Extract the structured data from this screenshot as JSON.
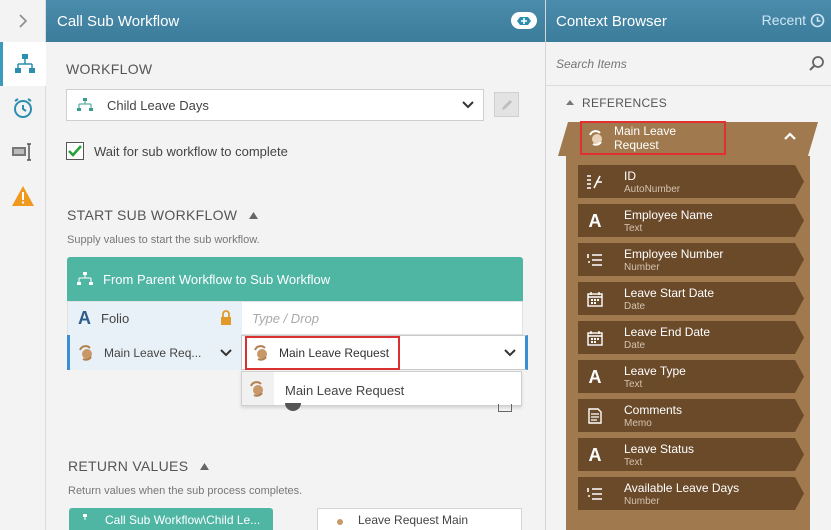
{
  "main": {
    "title": "Call Sub Workflow",
    "workflow_section": "WORKFLOW",
    "workflow_value": "Child Leave Days",
    "wait_label": "Wait for sub workflow to complete",
    "start_section": "START SUB WORKFLOW",
    "start_hint": "Supply values to start the sub workflow.",
    "mapping_title": "From Parent Workflow to Sub Workflow",
    "folio_label": "Folio",
    "value_placeholder": "Type / Drop",
    "param_label": "Main Leave Req...",
    "param_value": "Main Leave Request",
    "dropdown_option": "Main Leave Request",
    "return_section": "RETURN VALUES",
    "return_hint": "Return values when the sub process completes.",
    "return_card1": "Call Sub Workflow\\Child Le...",
    "return_card2": "Leave Request Main"
  },
  "context": {
    "title": "Context Browser",
    "recent_label": "Recent",
    "search_placeholder": "Search Items",
    "references_label": "REFERENCES",
    "reference_name": "Main Leave Request",
    "fields": [
      {
        "name": "ID",
        "type": "AutoNumber",
        "icon": "autonumber-icon"
      },
      {
        "name": "Employee Name",
        "type": "Text",
        "icon": "text-icon"
      },
      {
        "name": "Employee Number",
        "type": "Number",
        "icon": "number-icon"
      },
      {
        "name": "Leave Start Date",
        "type": "Date",
        "icon": "date-icon"
      },
      {
        "name": "Leave End Date",
        "type": "Date",
        "icon": "date-icon"
      },
      {
        "name": "Leave Type",
        "type": "Text",
        "icon": "text-icon"
      },
      {
        "name": "Comments",
        "type": "Memo",
        "icon": "memo-icon"
      },
      {
        "name": "Leave Status",
        "type": "Text",
        "icon": "text-icon"
      },
      {
        "name": "Available Leave Days",
        "type": "Number",
        "icon": "number-icon"
      }
    ]
  },
  "colors": {
    "header": "#4a89a9",
    "teal": "#4fb6a4",
    "brown_outer": "#a07a4e",
    "brown_inner": "#6b4a2a",
    "highlight": "#e23030"
  }
}
